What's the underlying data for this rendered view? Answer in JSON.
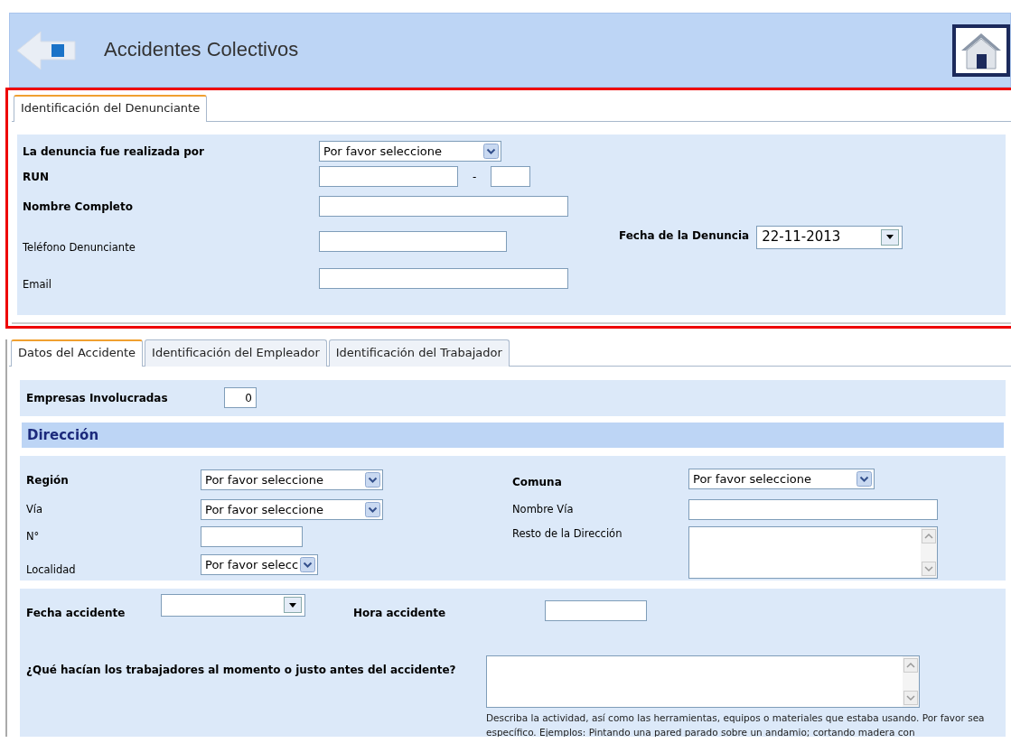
{
  "header": {
    "title": "Accidentes Colectivos"
  },
  "denunciante": {
    "tabs": [
      {
        "label": "Identificación del Denunciante",
        "selected": true
      }
    ],
    "fields": [
      {
        "label": "La denuncia fue realizada por",
        "bold": true,
        "kind": "select",
        "value": "Por favor seleccione"
      },
      {
        "label": "RUN",
        "bold": true,
        "kind": "run",
        "separator": "-"
      },
      {
        "label": "Nombre Completo",
        "bold": true,
        "kind": "text"
      },
      {
        "label": "Teléfono Denunciante",
        "bold": false,
        "kind": "text"
      },
      {
        "label": "Email",
        "bold": false,
        "kind": "text"
      }
    ],
    "date": {
      "label": "Fecha de la Denuncia",
      "value": "22-11-2013"
    }
  },
  "accidente": {
    "tabs": [
      {
        "label": "Datos del Accidente",
        "selected": true
      },
      {
        "label": "Identificación del Empleador",
        "selected": false
      },
      {
        "label": "Identificación del Trabajador",
        "selected": false
      }
    ],
    "empresas": {
      "label": "Empresas Involucradas",
      "value": "0"
    },
    "section_title": "Dirección",
    "address_left": [
      {
        "label": "Región",
        "bold": true,
        "kind": "select",
        "value": "Por favor seleccione"
      },
      {
        "label": "Vía",
        "bold": false,
        "kind": "select",
        "value": "Por favor seleccione"
      },
      {
        "label": "N°",
        "bold": false,
        "kind": "text"
      },
      {
        "label": "Localidad",
        "bold": false,
        "kind": "select",
        "value": "Por favor selecc"
      }
    ],
    "address_right": [
      {
        "label": "Comuna",
        "bold": true,
        "kind": "select",
        "value": "Por favor seleccione"
      },
      {
        "label": "Nombre Vía",
        "bold": false,
        "kind": "text"
      },
      {
        "label": "Resto de la Dirección",
        "bold": false,
        "kind": "textarea"
      }
    ],
    "fecha": {
      "label": "Fecha accidente"
    },
    "hora": {
      "label": "Hora accidente"
    },
    "question": {
      "label": "¿Qué hacían los trabajadores al momento o justo antes del accidente?",
      "hint": "Describa la actividad, así como las herramientas, equipos o materiales que estaba usando. Por favor sea específico. Ejemplos: Pintando una pared parado sobre un andamio; cortando madera con"
    }
  }
}
